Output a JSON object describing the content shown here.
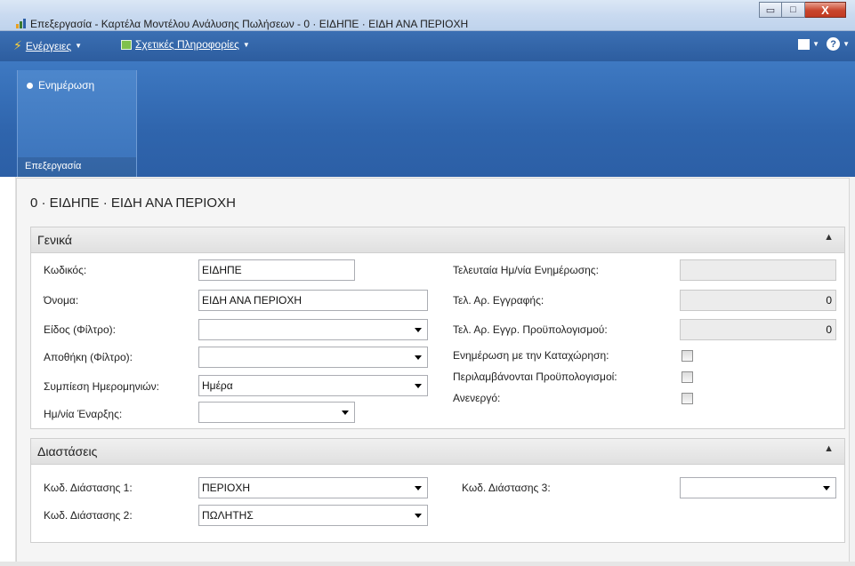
{
  "window": {
    "title": "Επεξεργασία - Καρτέλα Μοντέλου Ανάλυσης Πωλήσεων - 0 · ΕΙΔΗΠΕ · ΕΙΔΗ ΑΝΑ ΠΕΡΙΟΧΗ",
    "minimize": "▭",
    "maximize": "□",
    "close": "X"
  },
  "commandbar": {
    "actions_label": "Ενέργειες",
    "related_label": "Σχετικές Πληροφορίες",
    "help_label": "?"
  },
  "ribbon": {
    "update_label": "Ενημέρωση",
    "group_label": "Επεξεργασία"
  },
  "record_title": "0 · ΕΙΔΗΠΕ · ΕΙΔΗ ΑΝΑ ΠΕΡΙΟΧΗ",
  "general": {
    "title": "Γενικά",
    "code_label": "Κωδικός:",
    "code_value": "ΕΙΔΗΠΕ",
    "name_label": "Όνομα:",
    "name_value": "ΕΙΔΗ ΑΝΑ ΠΕΡΙΟΧΗ",
    "item_filter_label": "Είδος (Φίλτρο):",
    "item_filter_value": "",
    "location_filter_label": "Αποθήκη (Φίλτρο):",
    "location_filter_value": "",
    "date_compression_label": "Συμπίεση Ημερομηνιών:",
    "date_compression_value": "Ημέρα",
    "start_date_label": "Ημ/νία Έναρξης:",
    "start_date_value": "",
    "last_update_label": "Τελευταία Ημ/νία Ενημέρωσης:",
    "last_update_value": "",
    "last_entry_label": "Τελ. Αρ. Εγγραφής:",
    "last_entry_value": "0",
    "last_budget_entry_label": "Τελ. Αρ. Εγγρ. Προϋπολογισμού:",
    "last_budget_entry_value": "0",
    "update_on_posting_label": "Ενημέρωση με την Καταχώρηση:",
    "include_budgets_label": "Περιλαμβάνονται Προϋπολογισμοί:",
    "blocked_label": "Ανενεργό:"
  },
  "dimensions": {
    "title": "Διαστάσεις",
    "dim1_label": "Κωδ. Διάστασης 1:",
    "dim1_value": "ΠΕΡΙΟΧΗ",
    "dim2_label": "Κωδ. Διάστασης 2:",
    "dim2_value": "ΠΩΛΗΤΗΣ",
    "dim3_label": "Κωδ. Διάστασης 3:",
    "dim3_value": ""
  }
}
